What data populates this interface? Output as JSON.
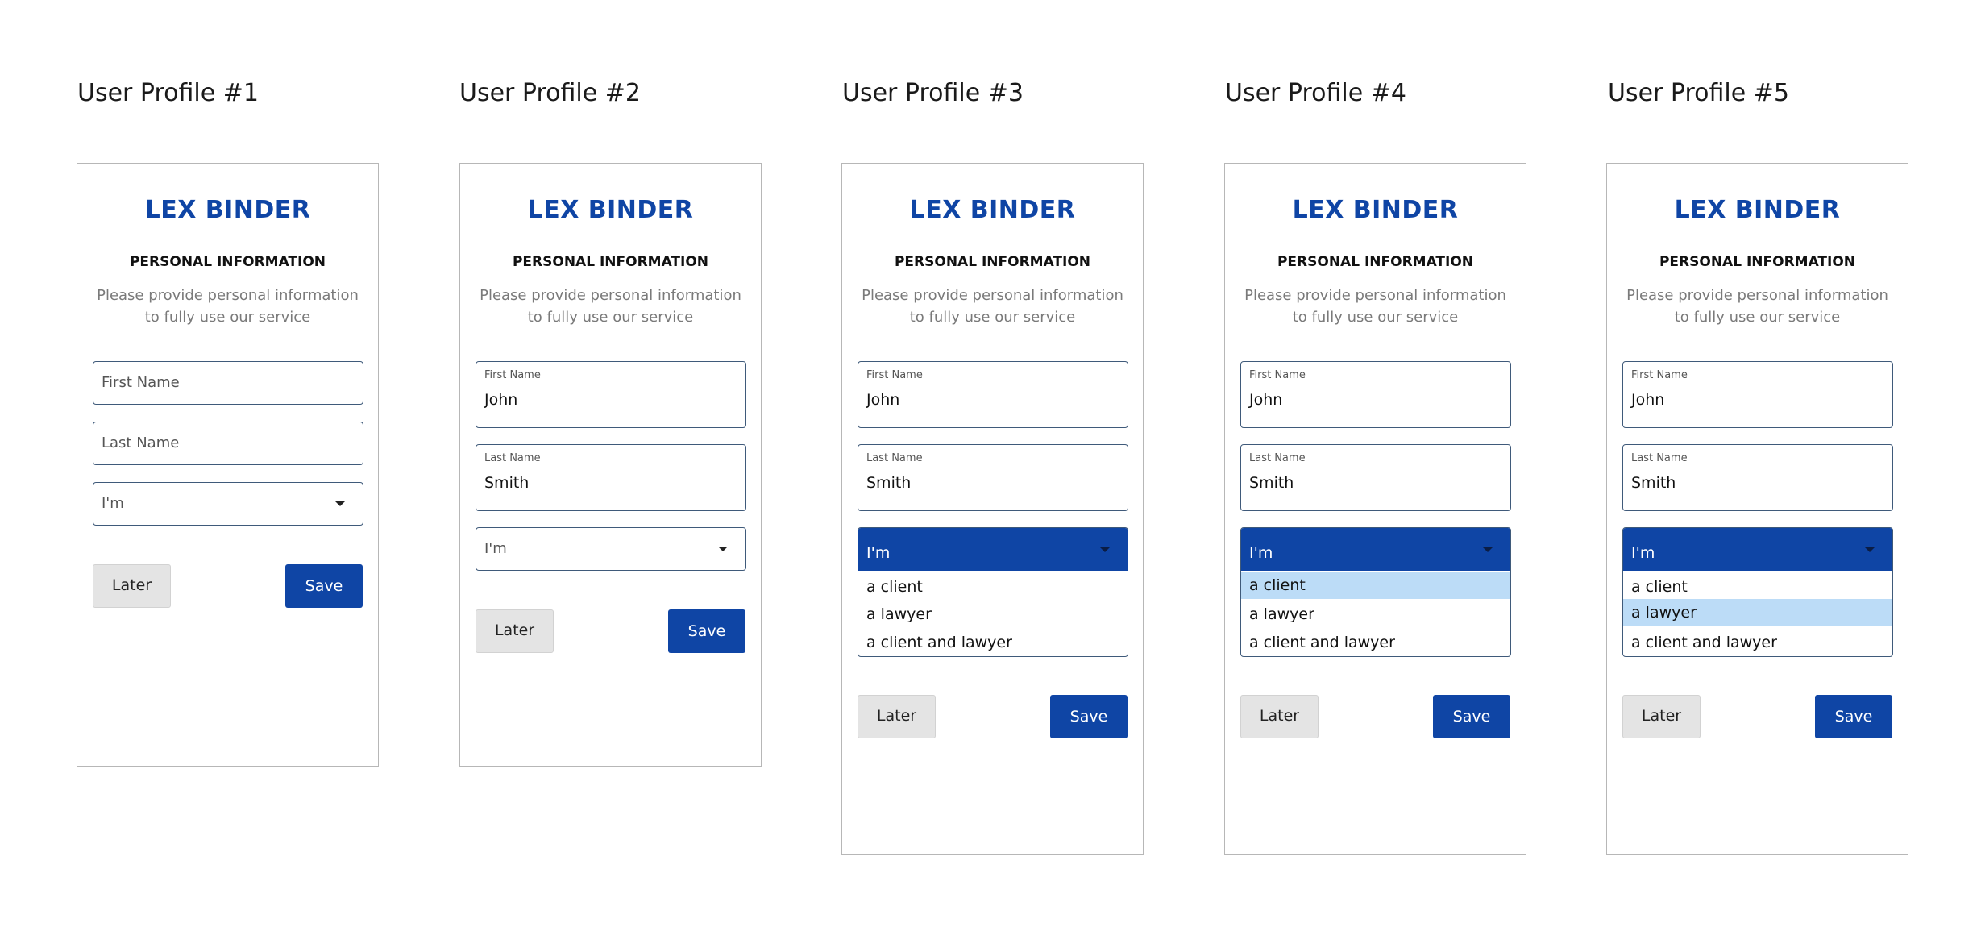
{
  "profiles": [
    {
      "title": "User Profile #1"
    },
    {
      "title": "User Profile #2"
    },
    {
      "title": "User Profile #3"
    },
    {
      "title": "User Profile #4"
    },
    {
      "title": "User Profile #5"
    }
  ],
  "form": {
    "logo": "LEX BINDER",
    "section_title": "PERSONAL INFORMATION",
    "description_line1": "Please provide personal information",
    "description_line2": "to fully use our service",
    "first_name_placeholder": "First Name",
    "last_name_placeholder": "Last Name",
    "first_name_label": "First Name",
    "last_name_label": "Last Name",
    "first_name_value": "John",
    "last_name_value": "Smith",
    "role_placeholder": "I'm",
    "role_options": [
      "a client",
      "a lawyer",
      "a client and lawyer"
    ],
    "later_label": "Later",
    "save_label": "Save"
  },
  "colors": {
    "brand": "#0f45a5",
    "option_highlight": "#bcdcf7",
    "later_button": "#e4e4e4"
  },
  "icons": {
    "dropdown_caret": "caret-down-icon"
  }
}
